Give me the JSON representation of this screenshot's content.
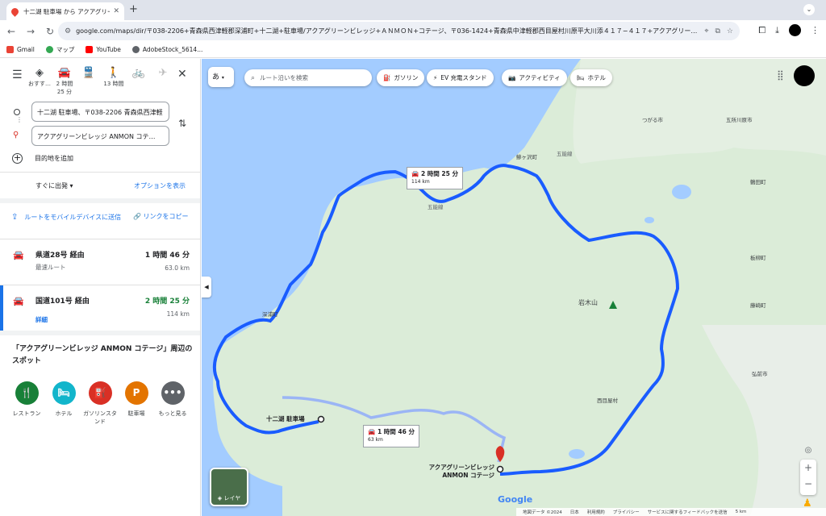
{
  "browser": {
    "tab_title": "十二湖 駐車場 から アクアグリー…",
    "url": "google.com/maps/dir/〒038-2206+青森県西津軽郡深浦町+十二湖+駐車場/アクアグリーンビレッジ+ＡＮＭＯＮ+コテージ、〒036-1424+青森県中津軽郡西目屋村川原平大川添４１７−４１７+アクアグリー…",
    "bookmarks": [
      "Gmail",
      "マップ",
      "YouTube",
      "AdobeStock_5614..."
    ]
  },
  "panel": {
    "modes": [
      {
        "label": "おすす…",
        "sub": ""
      },
      {
        "label": "2 時間",
        "sub": "25 分"
      },
      {
        "label": "",
        "sub": ""
      },
      {
        "label": "13 時間",
        "sub": ""
      },
      {
        "label": "",
        "sub": ""
      },
      {
        "label": "",
        "sub": ""
      }
    ],
    "origin": "十二湖 駐車場、〒038-2206 青森県西津軽",
    "destination": "アクアグリーンビレッジ ANMON コテ…",
    "add_destination": "目的地を追加",
    "depart": "すぐに出発",
    "options": "オプションを表示",
    "send_to_mobile": "ルートをモバイルデバイスに送信",
    "copy_link": "リンクをコピー",
    "routes": [
      {
        "name": "県道28号 経由",
        "time": "1 時間 46 分",
        "sub": "最速ルート",
        "dist": "63.0 km"
      },
      {
        "name": "国道101号 経由",
        "time": "2 時間 25 分",
        "sub": "詳細",
        "dist": "114 km"
      }
    ],
    "nearby_title": "「アクアグリーンビレッジ ANMON コテージ」周辺のスポット",
    "categories": [
      {
        "label": "レストラン",
        "color": "#188038",
        "glyph": "🍴"
      },
      {
        "label": "ホテル",
        "color": "#12b5cb",
        "glyph": "🛏"
      },
      {
        "label": "ガソリンスタンド",
        "color": "#d93025",
        "glyph": "⛽"
      },
      {
        "label": "駐車場",
        "color": "#e37400",
        "glyph": "P"
      },
      {
        "label": "もっと見る",
        "color": "#5f6368",
        "glyph": "•••"
      }
    ]
  },
  "map": {
    "lang_btn": "あ",
    "search_placeholder": "ルート沿いを検索",
    "chips": [
      "ガソリン",
      "EV 充電スタンド",
      "アクティビティ",
      "ホテル"
    ],
    "route_labels": [
      {
        "time": "2 時間 25 分",
        "dist": "114 km"
      },
      {
        "time": "1 時間 46 分",
        "dist": "63 km"
      }
    ],
    "places": [
      "つがる市",
      "五所川原市",
      "鰺ヶ沢町",
      "鶴田町",
      "板柳町",
      "岩木山",
      "藤崎町",
      "弘前市",
      "西目屋村",
      "深浦町",
      "五能線",
      "五能線"
    ],
    "origin_label": "十二湖 駐車場",
    "dest_label": "アクアグリーンビレッジ ANMON コテージ",
    "layers": "レイヤ",
    "footer": [
      "地図データ ©2024",
      "日本",
      "利用規約",
      "プライバシー",
      "サービスに関するフィードバックを送信",
      "5 km"
    ],
    "google": "Google",
    "colors": {
      "water": "#a3ccff",
      "land": "#dbecd8",
      "route_main": "#1a5cff",
      "route_alt": "#9bb5f5"
    }
  }
}
